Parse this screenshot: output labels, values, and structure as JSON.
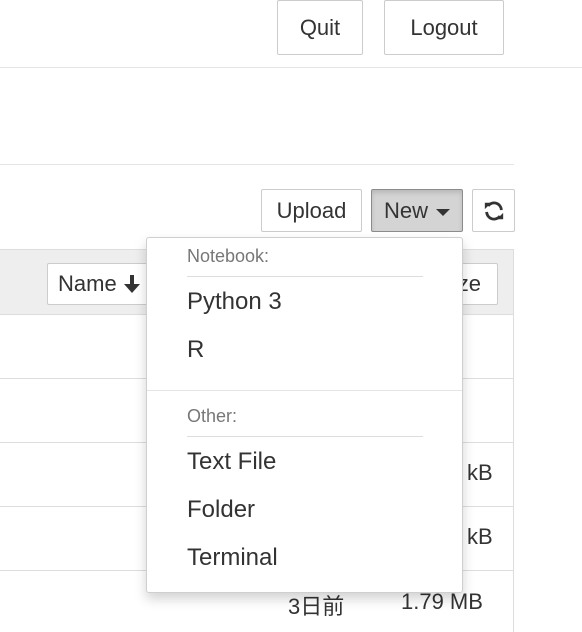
{
  "header": {
    "quit_label": "Quit",
    "logout_label": "Logout"
  },
  "toolbar": {
    "upload_label": "Upload",
    "new_label": "New",
    "refresh_icon": "refresh-icon"
  },
  "file_list": {
    "columns": {
      "name_label": "Name",
      "name_sort_icon": "arrow-down-icon",
      "size_label_partial": "ze"
    },
    "rows": [
      {
        "modified": "",
        "size": ""
      },
      {
        "modified": "",
        "size": ""
      },
      {
        "modified": "",
        "size": "kB"
      },
      {
        "modified": "",
        "size": "kB"
      },
      {
        "modified": "3日前",
        "size": "1.79 MB"
      }
    ]
  },
  "new_menu": {
    "notebook_header": "Notebook:",
    "notebook_items": [
      "Python 3",
      "R"
    ],
    "other_header": "Other:",
    "other_items": [
      "Text File",
      "Folder",
      "Terminal"
    ]
  }
}
